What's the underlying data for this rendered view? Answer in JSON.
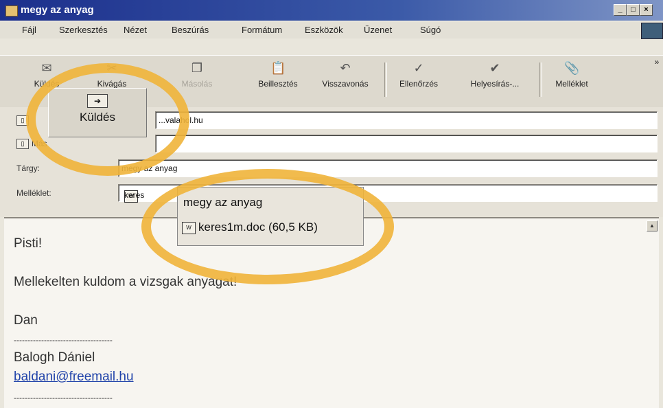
{
  "window": {
    "title": "megy az anyag",
    "min": "_",
    "max": "□",
    "close": "×"
  },
  "menu": [
    "Fájl",
    "Szerkesztés",
    "Nézet",
    "Beszúrás",
    "Formátum",
    "Eszközök",
    "Üzenet",
    "Súgó"
  ],
  "toolbar": {
    "send": "Küldés",
    "cut": "Kivágás",
    "copy": "Másolás",
    "paste": "Beillesztés",
    "undo": "Visszavonás",
    "check": "Ellenőrzés",
    "spell": "Helyesírás-...",
    "attach": "Melléklet",
    "more": "»"
  },
  "header": {
    "to_value": "...valahol.hu",
    "cc_label": "Más",
    "subject_label": "Tárgy:",
    "subject_value": "megy az anyag",
    "attachment_label": "Melléklet:",
    "attachment_value": "keres"
  },
  "popup": {
    "subject": "megy az anyag",
    "attachment": "keres1m.doc (60,5 KB)"
  },
  "body": {
    "greeting": "Pisti!",
    "line1": "Mellekelten kuldom a vizsgak anyagat!",
    "signoff": "Dan",
    "dashes": "------------------------------------",
    "name": "Balogh Dániel",
    "email": "baldani@freemail.hu",
    "dashes2": "------------------------------------"
  },
  "colors": {
    "highlight_ring": "#f0b43a",
    "title_bar": "#1c2f8c"
  }
}
